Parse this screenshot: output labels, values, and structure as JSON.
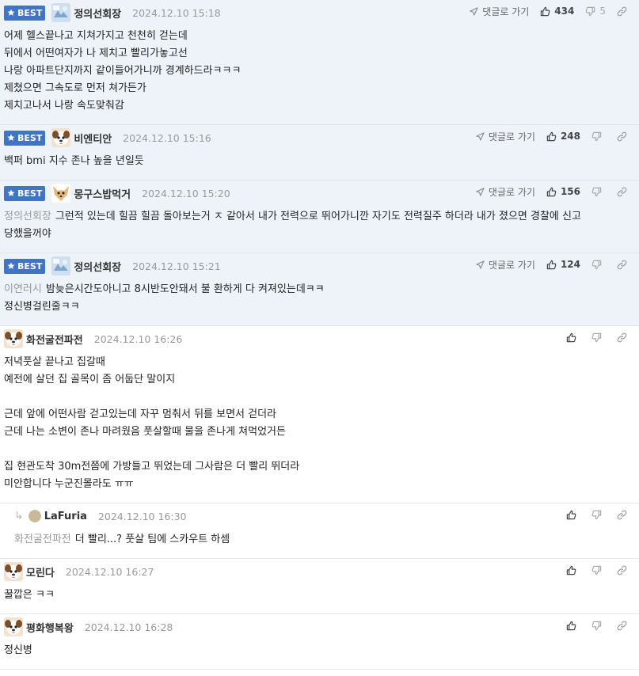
{
  "labels": {
    "best": "BEST",
    "goto": "댓글로 가기"
  },
  "comments": [
    {
      "best": true,
      "author": "정의선회장",
      "avatar": "ice-avatar",
      "date": "2024.12.10 15:18",
      "goto": true,
      "likes": "434",
      "dislikes": "5",
      "mention": "",
      "lines": [
        "어제 헬스끝나고 지쳐가지고 천천히 걷는데",
        "뒤에서 어떤여자가 나 제치고 빨리가놓고선",
        "나랑 아파트단지까지 같이들어가니까 경계하드라ㅋㅋㅋ",
        "제쳤으면 그속도로 먼저 쳐가든가",
        "제치고나서 나랑 속도맞춰감"
      ]
    },
    {
      "best": true,
      "author": "비엔티안",
      "avatar": "dog-avatar",
      "date": "2024.12.10 15:16",
      "goto": true,
      "likes": "248",
      "dislikes": "",
      "mention": "",
      "lines": [
        "백퍼 bmi 지수 존나 높을 년일듯"
      ]
    },
    {
      "best": true,
      "author": "몽구스밥먹거",
      "avatar": "chihuahua-avatar",
      "date": "2024.12.10 15:20",
      "goto": true,
      "likes": "156",
      "dislikes": "",
      "mention": "정의선회장",
      "lines": [
        "그런적 있는데 힐끔 힐끔 돌아보는거 ㅈ 같아서 내가 전력으로 뛰어가니깐 자기도 전력질주 하더라 내가 졌으면 경찰에 신고",
        "당했을꺼야"
      ]
    },
    {
      "best": true,
      "author": "정의선회장",
      "avatar": "ice-avatar",
      "date": "2024.12.10 15:21",
      "goto": true,
      "likes": "124",
      "dislikes": "",
      "mention": "이연러시",
      "lines": [
        "밤늦은시간도아니고 8시반도안돼서 불 환하게 다 켜져있는데ㅋㅋ",
        "정신병걸린줄ㅋㅋ"
      ]
    },
    {
      "best": false,
      "author": "화전굴전파전",
      "avatar": "dog-avatar",
      "date": "2024.12.10 16:26",
      "goto": false,
      "likes": "",
      "dislikes": "",
      "mention": "",
      "lines": [
        "저녁풋살 끝나고 집갈때",
        "예전에 살던 집 골목이 좀 어둡단 말이지",
        "",
        "근데 앞에 어떤사람 걷고있는데 자꾸 멈춰서 뒤를 보면서 걷더라",
        "근데 나는 소변이 존나 마려웠음 풋살할때 물을 존나게 쳐먹었거든",
        "",
        "집 현관도착 30m전쯤에 가방들고 뛰었는데 그사람은 더 빨리 뛰더라",
        "미안합니다 누군진몰라도 ㅠㅠ"
      ]
    },
    {
      "best": false,
      "reply": true,
      "author": "LaFuria",
      "avatar": "circle-avatar",
      "date": "2024.12.10 16:30",
      "goto": false,
      "likes": "",
      "dislikes": "",
      "mention": "화전굴전파전",
      "lines": [
        "더 빨리...? 풋살 팀에 스카우트 하셈"
      ]
    },
    {
      "best": false,
      "author": "모린다",
      "avatar": "dog-avatar",
      "date": "2024.12.10 16:27",
      "goto": false,
      "likes": "",
      "dislikes": "",
      "mention": "",
      "lines": [
        "꿀깝은 ㅋㅋ"
      ]
    },
    {
      "best": false,
      "author": "평화행복왕",
      "avatar": "dog-avatar",
      "date": "2024.12.10 16:28",
      "goto": false,
      "likes": "",
      "dislikes": "",
      "mention": "",
      "lines": [
        "정신병"
      ]
    }
  ]
}
